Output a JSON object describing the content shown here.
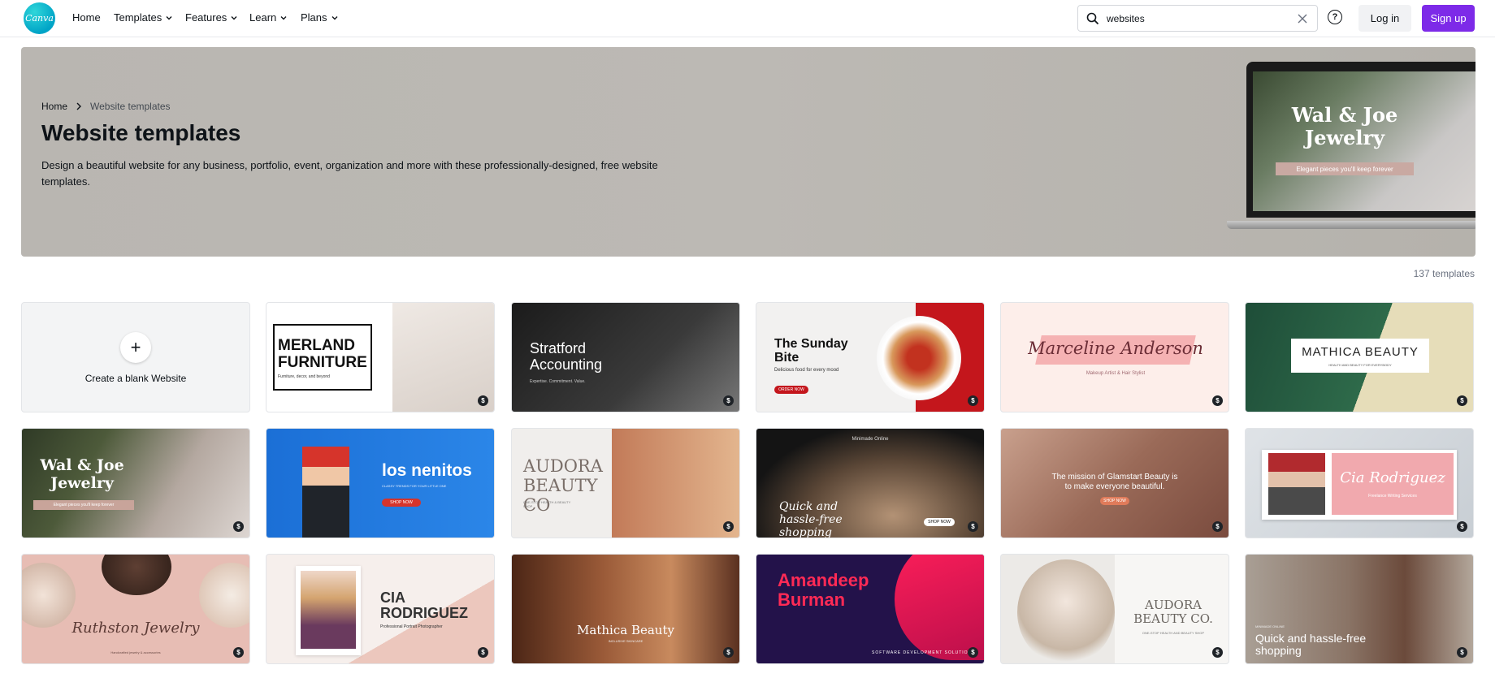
{
  "nav": {
    "logo_text": "Canva",
    "items": [
      {
        "label": "Home",
        "dropdown": false
      },
      {
        "label": "Templates",
        "dropdown": true
      },
      {
        "label": "Features",
        "dropdown": true
      },
      {
        "label": "Learn",
        "dropdown": true
      },
      {
        "label": "Plans",
        "dropdown": true
      }
    ],
    "search": {
      "value": "websites",
      "placeholder": "Search"
    },
    "login_label": "Log in",
    "signup_label": "Sign up",
    "help_symbol": "?"
  },
  "hero": {
    "breadcrumb": {
      "home": "Home",
      "current": "Website templates"
    },
    "title": "Website templates",
    "description": "Design a beautiful website for any business, portfolio, event, organization and more with these professionally-designed, free website templates.",
    "laptop_title": "Wal & Joe Jewelry",
    "laptop_subtitle": "Elegant pieces you'll keep forever"
  },
  "template_count": "137 templates",
  "blank_card": {
    "label": "Create a blank Website",
    "plus": "+"
  },
  "premium_badge": "$",
  "templates": [
    {
      "title": "MERLAND FURNITURE",
      "subtitle": "Furniture, decor, and beyond"
    },
    {
      "title": "Stratford Accounting",
      "subtitle": "Expertise. Commitment. Value."
    },
    {
      "title": "The Sunday Bite",
      "subtitle": "Delicious food for every mood",
      "button": "ORDER NOW"
    },
    {
      "title": "Marceline Anderson",
      "subtitle": "Makeup Artist & Hair Stylist"
    },
    {
      "title": "MATHICA BEAUTY",
      "subtitle": "HEALTH AND BEAUTY FOR EVERYBODY"
    },
    {
      "title": "Wal & Joe Jewelry",
      "subtitle": "Elegant pieces you'll keep forever"
    },
    {
      "title": "los nenitos",
      "subtitle": "CLASSY TRENDS FOR YOUR LITTLE ONE",
      "button": "SHOP NOW"
    },
    {
      "title": "AUDORA BEAUTY CO",
      "subtitle": "ONE-STOP HEALTH & BEAUTY SHOP"
    },
    {
      "title": "Quick and hassle-free shopping",
      "subtitle": "Minimade Online",
      "button": "SHOP NOW"
    },
    {
      "title": "The mission of Glamstart Beauty is to make everyone beautiful.",
      "button": "SHOP NOW"
    },
    {
      "title": "Cia Rodriguez",
      "subtitle": "Freelance Writing Services"
    },
    {
      "title": "Ruthston Jewelry",
      "subtitle": "Handcrafted jewelry & accessories"
    },
    {
      "title": "CIA RODRIGUEZ",
      "subtitle": "Professional Portrait Photographer"
    },
    {
      "title": "Mathica Beauty",
      "subtitle": "INCLUSIVE SKINCARE"
    },
    {
      "title": "Amandeep Burman",
      "subtitle": "SOFTWARE DEVELOPMENT SOLUTIONS"
    },
    {
      "title": "AUDORA BEAUTY CO.",
      "subtitle": "ONE-STOP HEALTH AND BEAUTY SHOP"
    },
    {
      "title": "Quick and hassle-free shopping",
      "subtitle": "MINIMADE ONLINE"
    }
  ],
  "colors": {
    "brand_purple": "#7d2ae8",
    "logo_teal": "#00c4cc"
  }
}
